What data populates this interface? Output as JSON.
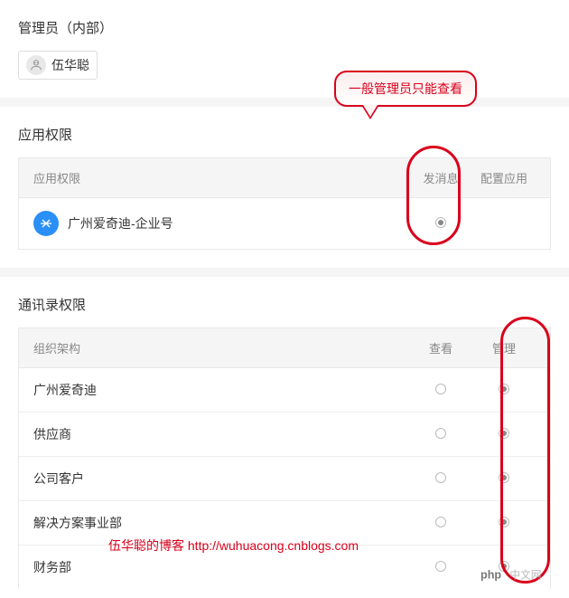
{
  "admin": {
    "section_title": "管理员（内部）",
    "user_name": "伍华聪"
  },
  "callout": {
    "text": "一般管理员只能查看"
  },
  "app_perm": {
    "section_title": "应用权限",
    "header_name": "应用权限",
    "header_col_a": "发消息",
    "header_col_b": "配置应用",
    "rows": [
      {
        "name": "广州爱奇迪-企业号",
        "send": true,
        "config": false
      }
    ]
  },
  "contact_perm": {
    "section_title": "通讯录权限",
    "header_name": "组织架构",
    "header_col_a": "查看",
    "header_col_b": "管理",
    "rows": [
      {
        "name": "广州爱奇迪",
        "view": false,
        "manage": true
      },
      {
        "name": "供应商",
        "view": false,
        "manage": true
      },
      {
        "name": "公司客户",
        "view": false,
        "manage": true
      },
      {
        "name": "解决方案事业部",
        "view": false,
        "manage": true
      },
      {
        "name": "财务部",
        "view": false,
        "manage": true
      }
    ]
  },
  "watermark": {
    "blog": "伍华聪的博客 http://wuhuacong.cnblogs.com",
    "site": "php中文网"
  },
  "colors": {
    "highlight": "#d9001b",
    "icon_bg": "#2a8ff7"
  }
}
